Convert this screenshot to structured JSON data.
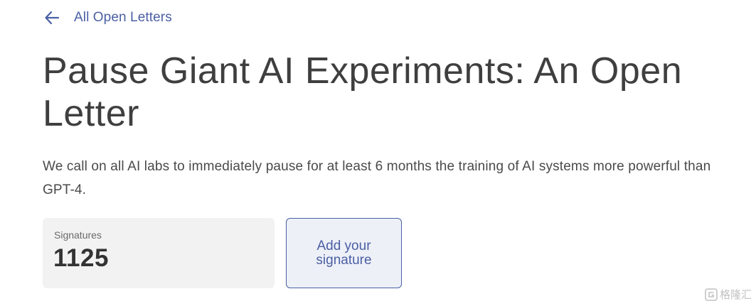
{
  "nav": {
    "back_label": "All Open Letters",
    "back_icon": "arrow-left-icon"
  },
  "letter": {
    "title": "Pause Giant AI Experiments: An Open Letter",
    "lede": "We call on all AI labs to immediately pause for at least 6 months the training of AI systems more powerful than GPT-4."
  },
  "signatures": {
    "label": "Signatures",
    "count": "1125"
  },
  "actions": {
    "add_signature_label": "Add your signature"
  },
  "watermark": {
    "text": "格隆汇",
    "icon": "glh-logo-icon"
  },
  "colors": {
    "accent": "#4a5fa4",
    "title_text": "#3f3f3f",
    "card_background": "#f2f2f2",
    "button_background": "#eef0f8"
  }
}
